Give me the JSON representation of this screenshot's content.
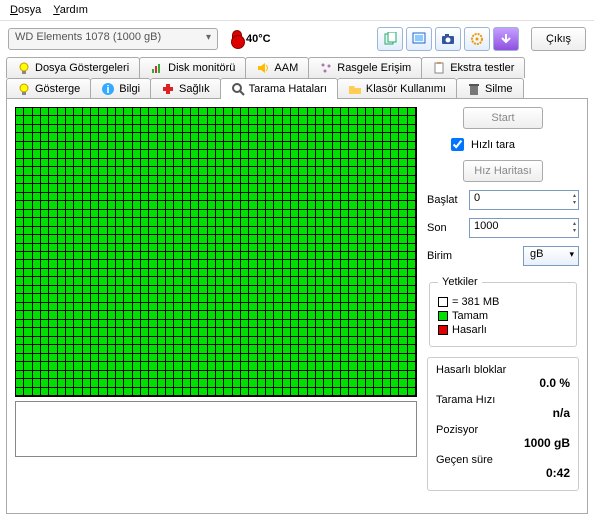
{
  "menu": {
    "file": "Dosya",
    "help": "Yardım"
  },
  "drive": "WD    Elements 1078 (1000 gB)",
  "temperature": "40°C",
  "exit": "Çıkış",
  "tabs_top": [
    {
      "label": "Dosya Göstergeleri"
    },
    {
      "label": "Disk monitörü"
    },
    {
      "label": "AAM"
    },
    {
      "label": "Rasgele Erişim"
    },
    {
      "label": "Ekstra testler"
    }
  ],
  "tabs_bottom": [
    {
      "label": "Gösterge"
    },
    {
      "label": "Bilgi"
    },
    {
      "label": "Sağlık"
    },
    {
      "label": "Tarama Hataları"
    },
    {
      "label": "Klasör Kullanımı"
    },
    {
      "label": "Silme"
    }
  ],
  "controls": {
    "start": "Start",
    "quick_scan": "Hızlı tara",
    "speed_map": "Hız Haritası",
    "begin_lbl": "Başlat",
    "begin_val": "0",
    "end_lbl": "Son",
    "end_val": "1000",
    "unit_lbl": "Birim",
    "unit_val": "gB"
  },
  "legend": {
    "title": "Yetkiler",
    "block_eq": "= 381 MB",
    "ok": "Tamam",
    "damaged": "Hasarlı"
  },
  "stats": {
    "damaged_lbl": "Hasarlı bloklar",
    "damaged_val": "0.0 %",
    "speed_lbl": "Tarama Hızı",
    "speed_val": "n/a",
    "pos_lbl": "Pozisyor",
    "pos_val": "1000 gB",
    "elapsed_lbl": "Geçen süre",
    "elapsed_val": "0:42"
  }
}
